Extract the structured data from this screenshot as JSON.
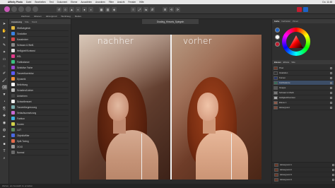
{
  "menubar": {
    "app_name": "Affinity Photo",
    "items": [
      "Datei",
      "Bearbeiten",
      "Text",
      "Dokument",
      "Ebene",
      "Auswählen",
      "Anordnen",
      "Filter",
      "Ansicht",
      "Fenster",
      "Hilfe"
    ],
    "right": "Do. 11:48"
  },
  "toolbar": {
    "personas": [
      "photo",
      "liquify",
      "develop",
      "tone-map",
      "export"
    ]
  },
  "contextbar": {
    "items": [
      "Zeichnen",
      "Ebenen",
      "Hintergrund",
      "Werkzeug",
      "Modus"
    ]
  },
  "document": {
    "tab_title": "Grading_Hinweis_Spiegeln"
  },
  "canvas": {
    "label_left": "nachher",
    "label_right": "vorher"
  },
  "left_panel": {
    "tabs": [
      "Anpassung",
      "Stile",
      "Stock"
    ],
    "items": [
      {
        "label": "Weißabgleich",
        "color": "#e0b840"
      },
      {
        "label": "Gradation",
        "color": "#3a82e2"
      },
      {
        "label": "Kanalmixer",
        "color": "#d24a4a"
      },
      {
        "label": "Schwarz & Weiß",
        "color": "#888888"
      },
      {
        "label": "Helligkeit/Kontrast",
        "color": "#e0e0e0"
      },
      {
        "label": "HSL",
        "color": "#e03a8a"
      },
      {
        "label": "Farbbalance",
        "color": "#3ac080"
      },
      {
        "label": "Selektive Farbe",
        "color": "#9a4ad2"
      },
      {
        "label": "Tonwertkorrektur",
        "color": "#5a5aff"
      },
      {
        "label": "Dynamik",
        "color": "#f0903a"
      },
      {
        "label": "Belichtung",
        "color": "#ffffff"
      },
      {
        "label": "Schatten/Lichter",
        "color": "#bbbbbb"
      },
      {
        "label": "Umkehren",
        "color": "#444444"
      },
      {
        "label": "Schwellenwert",
        "color": "#eeeeee"
      },
      {
        "label": "Tonwertbegrenzung",
        "color": "#7aa"
      },
      {
        "label": "Verlaufsumsetzung",
        "color": "#c86ad2"
      },
      {
        "label": "Farbton",
        "color": "#3ab0e0"
      },
      {
        "label": "Kurven",
        "color": "#d2d24a"
      },
      {
        "label": "LUT",
        "color": "#5a8a5a"
      },
      {
        "label": "Objektivfilter",
        "color": "#4a6ae2"
      },
      {
        "label": "Split-Toning",
        "color": "#e26a4a"
      },
      {
        "label": "OCIO",
        "color": "#999999"
      },
      {
        "label": "Normal",
        "color": "#6a6a6a"
      }
    ]
  },
  "right_panel": {
    "color_tabs": [
      "Farbe",
      "Farbfelder",
      "Pinsel"
    ],
    "layers_tabs": [
      "Ebenen",
      "Effekte",
      "Stile"
    ],
    "layers": [
      {
        "label": "Pixel",
        "selected": false
      },
      {
        "label": "Gradation",
        "selected": false
      },
      {
        "label": "Kurven",
        "selected": false
      },
      {
        "label": "Farbbalance",
        "selected": true
      },
      {
        "label": "Gruppe",
        "selected": false
      },
      {
        "label": "Schwarz & Weiß",
        "selected": false
      },
      {
        "label": "Helligkeit/Kontrast",
        "selected": false
      },
      {
        "label": "Ebene 1",
        "selected": false
      },
      {
        "label": "Hintergrund",
        "selected": false
      }
    ],
    "lower_layers": [
      {
        "label": "Hintergrund 1"
      },
      {
        "label": "Hintergrund 2"
      },
      {
        "label": "Hintergrund 3"
      },
      {
        "label": "Hintergrund 4"
      }
    ]
  },
  "statusbar": {
    "text": "Ziehen, um Auswahl zu erstellen."
  }
}
